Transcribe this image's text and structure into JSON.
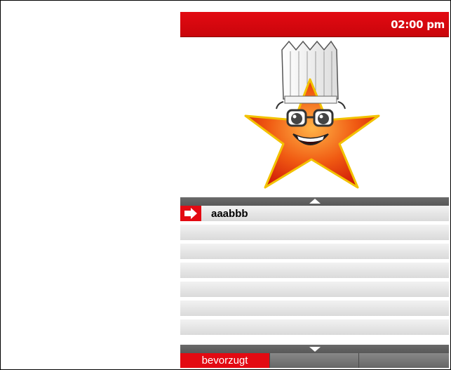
{
  "status_bar": {
    "time": "02:00 pm"
  },
  "mascot": {
    "icon": "chef-star-mascot-icon"
  },
  "list": {
    "items": [
      {
        "label": "aaabbb",
        "selected": true
      },
      {
        "label": "",
        "selected": false
      },
      {
        "label": "",
        "selected": false
      },
      {
        "label": "",
        "selected": false
      },
      {
        "label": "",
        "selected": false
      },
      {
        "label": "",
        "selected": false
      },
      {
        "label": "",
        "selected": false
      }
    ]
  },
  "tabs": [
    {
      "label": "bevorzugt",
      "active": true
    },
    {
      "label": "",
      "active": false
    },
    {
      "label": "",
      "active": false
    }
  ],
  "colors": {
    "accent": "#e30a12",
    "scrollbar": "#5e5e5e",
    "row": "#e4e4e4"
  }
}
